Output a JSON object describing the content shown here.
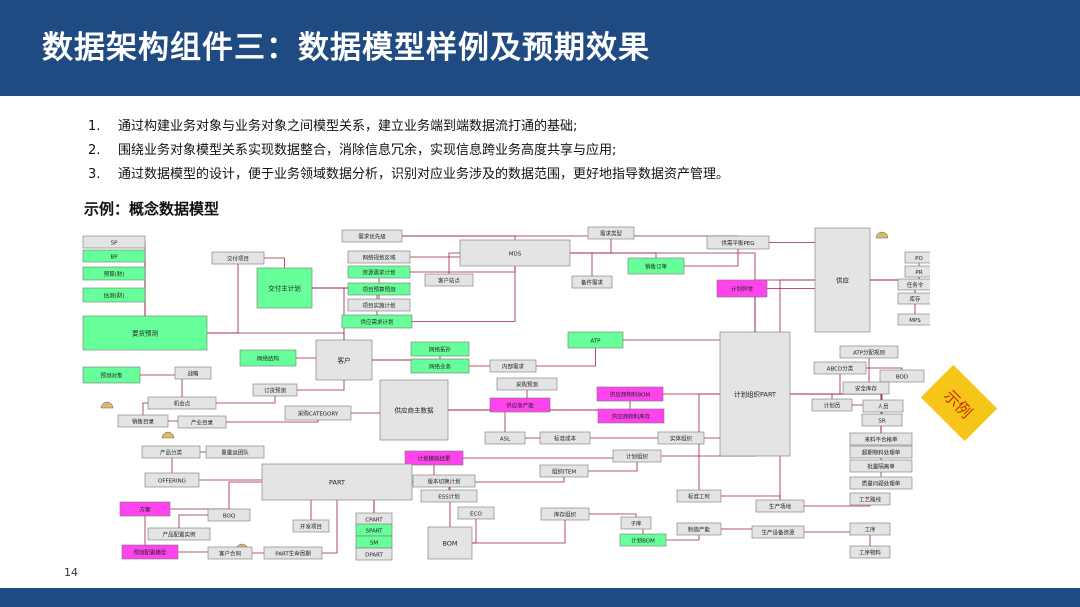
{
  "title": "数据架构组件三：数据模型样例及预期效果",
  "points": [
    {
      "num": "1.",
      "text": "通过构建业务对象与业务对象之间模型关系，建立业务端到端数据流打通的基础;"
    },
    {
      "num": "2.",
      "text": "围绕业务对象模型关系实现数据整合，消除信息冗余，实现信息跨业务高度共享与应用;"
    },
    {
      "num": "3.",
      "text": "通过数据模型的设计，便于业务领域数据分析，识别对应业务涉及的数据范围，更好地指导数据资产管理。"
    }
  ],
  "example_title": "示例：概念数据模型",
  "stamp": "示例",
  "page_number": "14",
  "colors": {
    "header": "#1f4a82",
    "line": "#a0223a",
    "green": "#66ff99",
    "magenta": "#ff44ee",
    "gray": "#e4e4e4"
  },
  "diagram": {
    "entities": [
      {
        "id": "sp",
        "label": "SP",
        "fill": "gray"
      },
      {
        "id": "bp",
        "label": "BP",
        "fill": "green"
      },
      {
        "id": "ysc",
        "label": "预算(财)",
        "fill": "green"
      },
      {
        "id": "gsc",
        "label": "估测(财)",
        "fill": "green"
      },
      {
        "id": "yhyc",
        "label": "要货预测",
        "fill": "green"
      },
      {
        "id": "jfxm",
        "label": "交付项目",
        "fill": "gray"
      },
      {
        "id": "jfzjh",
        "label": "交付主计划",
        "fill": "green"
      },
      {
        "id": "xqyxj",
        "label": "需求优先级",
        "fill": "gray"
      },
      {
        "id": "wlghqy",
        "label": "网络规划区域",
        "fill": "gray"
      },
      {
        "id": "zyxqjh",
        "label": "资源需求计划",
        "fill": "green"
      },
      {
        "id": "xmgsyc",
        "label": "项目预算预测",
        "fill": "green"
      },
      {
        "id": "xmssjh",
        "label": "项目实施计划",
        "fill": "gray"
      },
      {
        "id": "gyxqjh",
        "label": "供应需求计划",
        "fill": "green"
      },
      {
        "id": "mds",
        "label": "MDS",
        "fill": "gray"
      },
      {
        "id": "xqlx",
        "label": "需求类型",
        "fill": "gray"
      },
      {
        "id": "khzd",
        "label": "客户站点",
        "fill": "gray"
      },
      {
        "id": "bjxq",
        "label": "备件需求",
        "fill": "gray"
      },
      {
        "id": "xsdd",
        "label": "销售订单",
        "fill": "green"
      },
      {
        "id": "gxphpeg",
        "label": "供需平衡PEG",
        "fill": "gray"
      },
      {
        "id": "jhyc",
        "label": "计划异常",
        "fill": "magenta"
      },
      {
        "id": "gy",
        "label": "供应",
        "fill": "gray"
      },
      {
        "id": "po",
        "label": "PO",
        "fill": "gray"
      },
      {
        "id": "pr",
        "label": "PR",
        "fill": "gray"
      },
      {
        "id": "rwl",
        "label": "任务令",
        "fill": "gray"
      },
      {
        "id": "kc",
        "label": "库存",
        "fill": "gray"
      },
      {
        "id": "mps",
        "label": "MPS",
        "fill": "gray"
      },
      {
        "id": "atp",
        "label": "ATP",
        "fill": "green"
      },
      {
        "id": "wljg",
        "label": "网络结构",
        "fill": "green"
      },
      {
        "id": "kh",
        "label": "客户",
        "fill": "gray"
      },
      {
        "id": "wltp",
        "label": "网络拓扑",
        "fill": "green"
      },
      {
        "id": "wlyw",
        "label": "网络业务",
        "fill": "green"
      },
      {
        "id": "nbxq",
        "label": "内部需求",
        "fill": "gray"
      },
      {
        "id": "ycdx",
        "label": "预测对象",
        "fill": "green"
      },
      {
        "id": "zl",
        "label": "战略",
        "fill": "gray"
      },
      {
        "id": "dhyc",
        "label": "订货预测",
        "fill": "gray"
      },
      {
        "id": "jhd",
        "label": "机会点",
        "fill": "gray"
      },
      {
        "id": "cgyc",
        "label": "采购预测",
        "fill": "gray"
      },
      {
        "id": "gysfdbom",
        "label": "供应商物料BOM",
        "fill": "magenta"
      },
      {
        "id": "gyscn",
        "label": "供应商产能",
        "fill": "magenta"
      },
      {
        "id": "gyswlkc",
        "label": "供应商物料库存",
        "fill": "magenta"
      },
      {
        "id": "jhzzpart",
        "label": "计划组织PART",
        "fill": "gray"
      },
      {
        "id": "atpfp",
        "label": "ATP分配规则",
        "fill": "gray"
      },
      {
        "id": "abcd",
        "label": "ABCD分类",
        "fill": "gray"
      },
      {
        "id": "bod",
        "label": "BOD",
        "fill": "gray"
      },
      {
        "id": "aqkc",
        "label": "安全库存",
        "fill": "gray"
      },
      {
        "id": "jhy",
        "label": "计划员",
        "fill": "gray"
      },
      {
        "id": "ry",
        "label": "人员",
        "fill": "gray"
      },
      {
        "id": "sr",
        "label": "SR",
        "fill": "gray"
      },
      {
        "id": "xsml",
        "label": "销售目录",
        "fill": "gray"
      },
      {
        "id": "cpml",
        "label": "产业目录",
        "fill": "gray"
      },
      {
        "id": "cgcat",
        "label": "采购CATEGORY",
        "fill": "gray"
      },
      {
        "id": "gyszsj",
        "label": "供应商主数据",
        "fill": "gray"
      },
      {
        "id": "asl",
        "label": "ASL",
        "fill": "gray"
      },
      {
        "id": "bzcb",
        "label": "标准成本",
        "fill": "gray"
      },
      {
        "id": "stzz",
        "label": "实体组织",
        "fill": "gray"
      },
      {
        "id": "lpbhd",
        "label": "来料不合格单",
        "fill": "gray"
      },
      {
        "id": "cpfl",
        "label": "产品分类",
        "fill": "gray"
      },
      {
        "id": "zlgtd",
        "label": "重量运团队",
        "fill": "gray"
      },
      {
        "id": "jhmnsc",
        "label": "计划模拟结果",
        "fill": "magenta"
      },
      {
        "id": "jhzz",
        "label": "计划组织",
        "fill": "gray"
      },
      {
        "id": "cxcl",
        "label": "超期物料处理单",
        "fill": "gray"
      },
      {
        "id": "offering",
        "label": "OFFERING",
        "fill": "gray"
      },
      {
        "id": "part",
        "label": "PART",
        "fill": "gray"
      },
      {
        "id": "zzitem",
        "label": "组织ITEM",
        "fill": "gray"
      },
      {
        "id": "plxd",
        "label": "批量隔离单",
        "fill": "gray"
      },
      {
        "id": "bbqhjh",
        "label": "版本切换计划",
        "fill": "gray"
      },
      {
        "id": "zlwtcl",
        "label": "质量问题处理单",
        "fill": "gray"
      },
      {
        "id": "essjh",
        "label": "ESS计划",
        "fill": "gray"
      },
      {
        "id": "bzgs",
        "label": "标准工时",
        "fill": "gray"
      },
      {
        "id": "gylx",
        "label": "工艺路线",
        "fill": "gray"
      },
      {
        "id": "fa",
        "label": "方案",
        "fill": "magenta"
      },
      {
        "id": "boq",
        "label": "BOQ",
        "fill": "gray"
      },
      {
        "id": "eco",
        "label": "ECO",
        "fill": "gray"
      },
      {
        "id": "sccd",
        "label": "生产场地",
        "fill": "gray"
      },
      {
        "id": "kcjz",
        "label": "库存组织",
        "fill": "gray"
      },
      {
        "id": "zk",
        "label": "子库",
        "fill": "gray"
      },
      {
        "id": "cppzsl",
        "label": "产品配置实例",
        "fill": "gray"
      },
      {
        "id": "kfxm",
        "label": "开发项目",
        "fill": "gray"
      },
      {
        "id": "cpart",
        "label": "CPART",
        "fill": "gray"
      },
      {
        "id": "spart",
        "label": "SPART",
        "fill": "green"
      },
      {
        "id": "sm",
        "label": "SM",
        "fill": "green"
      },
      {
        "id": "dpart",
        "label": "DPART",
        "fill": "gray"
      },
      {
        "id": "bom",
        "label": "BOM",
        "fill": "gray"
      },
      {
        "id": "zzcn",
        "label": "制造产能",
        "fill": "gray"
      },
      {
        "id": "scsbzy",
        "label": "生产设备资源",
        "fill": "gray"
      },
      {
        "id": "gx",
        "label": "工序",
        "fill": "gray"
      },
      {
        "id": "jhbom",
        "label": "计划BOM",
        "fill": "green"
      },
      {
        "id": "ycpzmx",
        "label": "预测配置模型",
        "fill": "magenta"
      },
      {
        "id": "khht",
        "label": "客户合同",
        "fill": "gray"
      },
      {
        "id": "partsmzq",
        "label": "PART生命周期",
        "fill": "gray"
      },
      {
        "id": "gxwl",
        "label": "工序物料",
        "fill": "gray"
      }
    ]
  }
}
